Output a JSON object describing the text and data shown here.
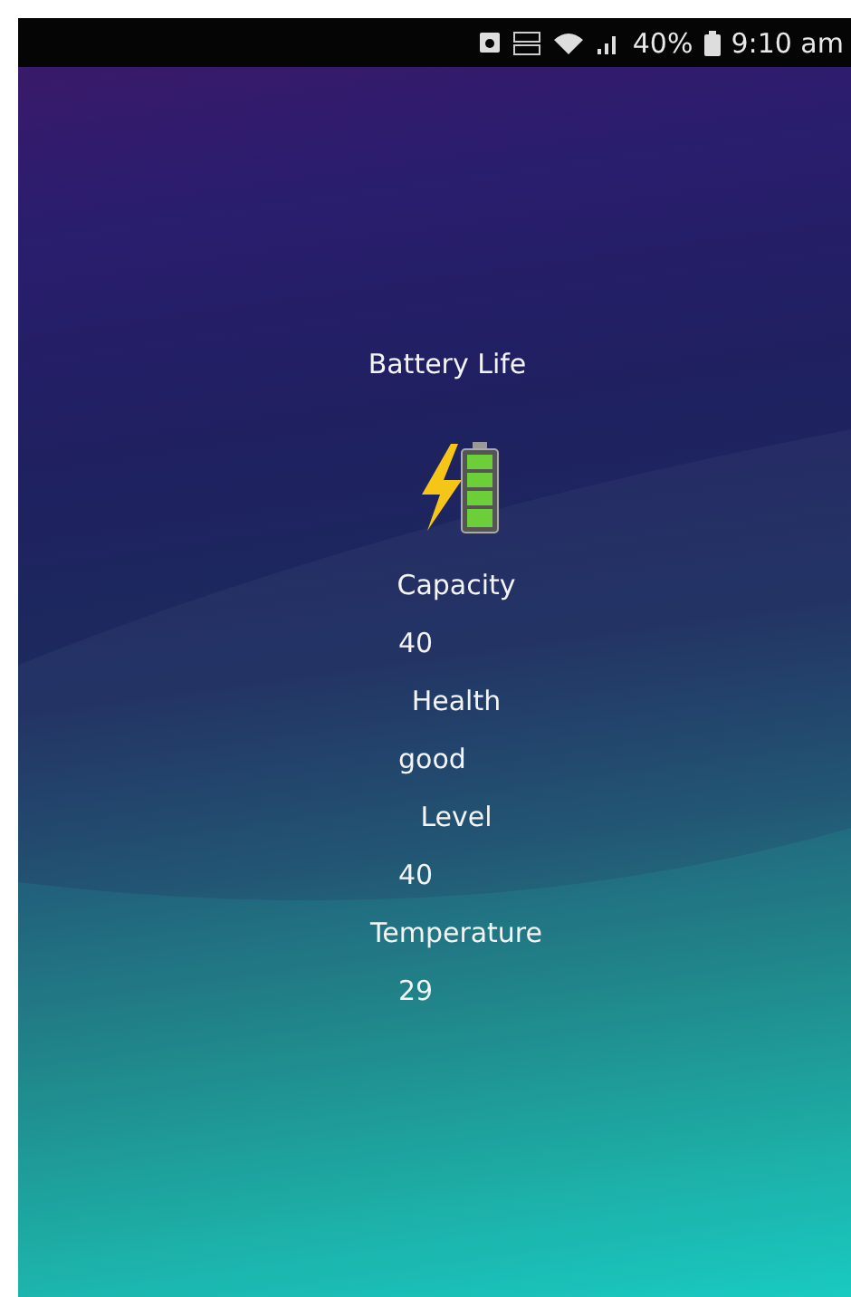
{
  "status_bar": {
    "battery_percent": "40%",
    "time": "9:10 am"
  },
  "title": "Battery Life",
  "stats": [
    {
      "kind": "label",
      "text": "Capacity"
    },
    {
      "kind": "value",
      "text": "40"
    },
    {
      "kind": "label",
      "text": "Health"
    },
    {
      "kind": "value",
      "text": "good"
    },
    {
      "kind": "label",
      "text": "Level"
    },
    {
      "kind": "value",
      "text": "40"
    },
    {
      "kind": "label",
      "text": "Temperature"
    },
    {
      "kind": "value",
      "text": "29"
    }
  ]
}
